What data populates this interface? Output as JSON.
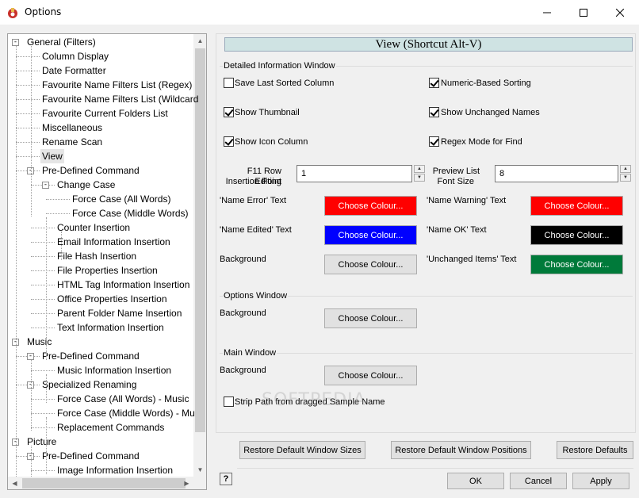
{
  "window": {
    "title": "Options",
    "minimize": "—",
    "maximize": "☐",
    "close": "✕"
  },
  "tree": {
    "items": [
      {
        "label": "General  (Filters)",
        "level": 0,
        "exp": "-"
      },
      {
        "label": "Column Display",
        "level": 1
      },
      {
        "label": "Date Formatter",
        "level": 1
      },
      {
        "label": "Favourite Name Filters List (Regex)",
        "level": 1
      },
      {
        "label": "Favourite Name Filters List (Wildcard",
        "level": 1
      },
      {
        "label": "Favourite Current Folders List",
        "level": 1
      },
      {
        "label": "Miscellaneous",
        "level": 1
      },
      {
        "label": "Rename Scan",
        "level": 1
      },
      {
        "label": "View",
        "level": 1,
        "selected": true
      },
      {
        "label": "Pre-Defined Command",
        "level": 1,
        "exp": "-"
      },
      {
        "label": "Change Case",
        "level": 2,
        "exp": "-"
      },
      {
        "label": "Force Case (All Words)",
        "level": 3
      },
      {
        "label": "Force Case (Middle Words)",
        "level": 3
      },
      {
        "label": "Counter Insertion",
        "level": 2
      },
      {
        "label": "Email Information Insertion",
        "level": 2
      },
      {
        "label": "File Hash Insertion",
        "level": 2
      },
      {
        "label": "File Properties Insertion",
        "level": 2
      },
      {
        "label": "HTML Tag Information Insertion",
        "level": 2
      },
      {
        "label": "Office Properties Insertion",
        "level": 2
      },
      {
        "label": "Parent Folder Name Insertion",
        "level": 2
      },
      {
        "label": "Text Information Insertion",
        "level": 2
      },
      {
        "label": "Music",
        "level": 0,
        "exp": "-"
      },
      {
        "label": "Pre-Defined Command",
        "level": 1,
        "exp": "-"
      },
      {
        "label": "Music Information Insertion",
        "level": 2
      },
      {
        "label": "Specialized Renaming",
        "level": 1,
        "exp": "-"
      },
      {
        "label": "Force Case (All Words) - Music",
        "level": 2
      },
      {
        "label": "Force Case (Middle Words) - Mu",
        "level": 2
      },
      {
        "label": "Replacement Commands",
        "level": 2
      },
      {
        "label": "Picture",
        "level": 0,
        "exp": "-"
      },
      {
        "label": "Pre-Defined Command",
        "level": 1,
        "exp": "-"
      },
      {
        "label": "Image Information Insertion",
        "level": 2
      }
    ]
  },
  "header": {
    "title": "View        (Shortcut Alt-V)"
  },
  "detailed": {
    "group": "Detailed Information Window",
    "save_last_sorted": "Save Last Sorted Column",
    "numeric_sorting": "Numeric-Based Sorting",
    "show_thumbnail": "Show Thumbnail",
    "show_unchanged": "Show Unchanged Names",
    "show_icon_column": "Show Icon Column",
    "regex_mode": "Regex Mode for Find",
    "f11_label_1": "F11 Row Editing",
    "f11_label_2": "Insertion Point",
    "f11_value": "1",
    "preview_label_1": "Preview List",
    "preview_label_2": "Font Size",
    "preview_value": "8",
    "name_error": "'Name Error' Text",
    "name_warning": "'Name Warning' Text",
    "name_edited": "'Name Edited' Text",
    "name_ok": "'Name OK' Text",
    "background": "Background",
    "unchanged_items": "'Unchanged Items' Text",
    "choose_colour": "Choose Colour..."
  },
  "colors": {
    "name_error": "#ff0000",
    "name_warning": "#ff0000",
    "name_edited": "#0000ff",
    "name_ok": "#000000",
    "background": "#e1e1e1",
    "unchanged_items": "#007a3a"
  },
  "options_window": {
    "group": "Options Window",
    "background": "Background",
    "choose_colour": "Choose Colour..."
  },
  "main_window": {
    "group": "Main Window",
    "background": "Background",
    "choose_colour": "Choose Colour...",
    "strip_path": "Strip Path from dragged Sample Name"
  },
  "restore": {
    "window_sizes": "Restore Default Window Sizes",
    "window_positions": "Restore Default Window Positions",
    "defaults": "Restore Defaults"
  },
  "footer": {
    "help": "?",
    "ok": "OK",
    "cancel": "Cancel",
    "apply": "Apply"
  },
  "watermark": "SOFTPEDIA"
}
